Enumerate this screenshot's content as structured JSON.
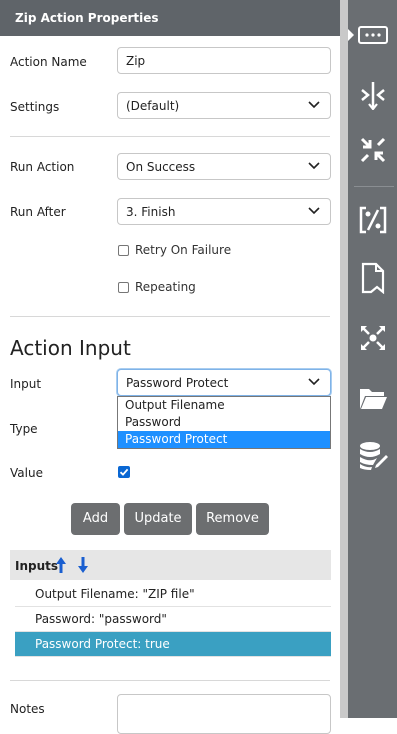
{
  "panel": {
    "title": "Zip Action Properties"
  },
  "form": {
    "action_name_label": "Action Name",
    "action_name_value": "Zip",
    "settings_label": "Settings",
    "settings_value": "(Default)",
    "run_action_label": "Run Action",
    "run_action_value": "On Success",
    "run_after_label": "Run After",
    "run_after_value": "3. Finish",
    "retry_label": "Retry On Failure",
    "retry_checked": false,
    "repeating_label": "Repeating",
    "repeating_checked": false
  },
  "action_input": {
    "section_title": "Action Input",
    "input_label": "Input",
    "input_value": "Password Protect",
    "input_options": [
      "Output Filename",
      "Password",
      "Password Protect"
    ],
    "input_selected_index": 2,
    "type_label": "Type",
    "value_label": "Value",
    "value_checked": true,
    "buttons": {
      "add": "Add",
      "update": "Update",
      "remove": "Remove"
    }
  },
  "inputs_list": {
    "header": "Inputs",
    "rows": [
      "Output Filename: \"ZIP file\"",
      "Password: \"password\"",
      "Password Protect: true"
    ],
    "selected_index": 2
  },
  "notes": {
    "label": "Notes"
  },
  "rail": {
    "icons": [
      "ellipsis-box-icon",
      "merge-arrows-icon",
      "collapse-arrows-icon",
      "percent-code-icon",
      "document-ribbon-icon",
      "scatter-arrows-icon",
      "folder-icon",
      "database-edit-icon"
    ],
    "active_index": 0
  },
  "colors": {
    "header_bg": "#5f6469",
    "rail_bg": "#6a6e72",
    "button_bg": "#6c6e70",
    "selected_row": "#3aa0c2",
    "dropdown_selected": "#1e90ff",
    "checkbox_checked": "#0a67d3",
    "sort_arrow": "#1a5fd0"
  }
}
